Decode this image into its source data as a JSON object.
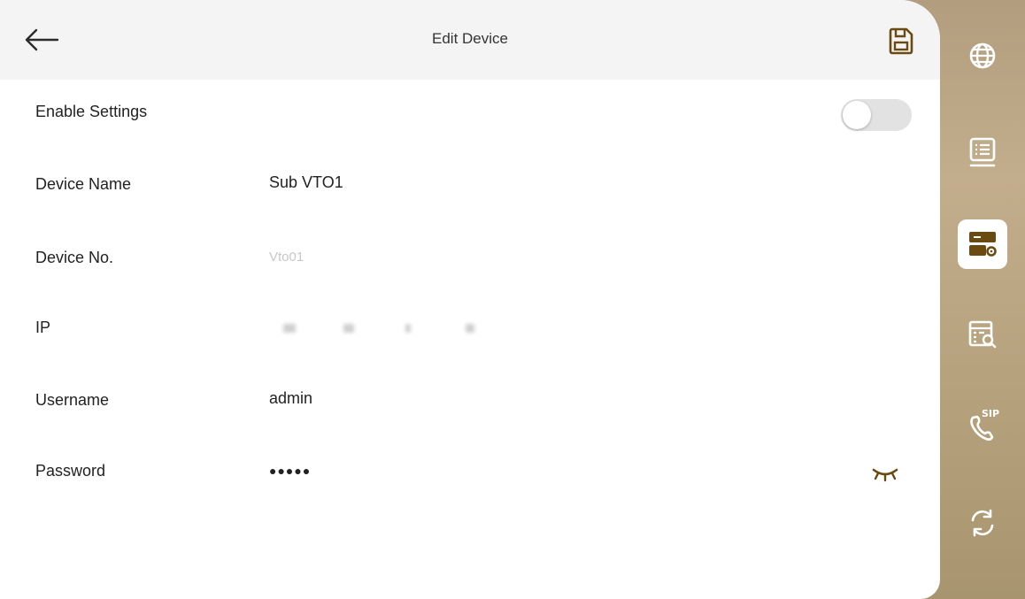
{
  "header": {
    "title": "Edit Device",
    "back_icon": "arrow-left-icon",
    "save_icon": "save-icon"
  },
  "form": {
    "enable_settings": {
      "label": "Enable Settings",
      "enabled": false
    },
    "device_name": {
      "label": "Device Name",
      "value": "Sub VTO1"
    },
    "device_no": {
      "label": "Device No.",
      "value": "Vto01"
    },
    "ip": {
      "label": "IP"
    },
    "username": {
      "label": "Username",
      "value": "admin"
    },
    "password": {
      "label": "Password",
      "value": "●●●●●"
    }
  },
  "sidebar": {
    "items": [
      {
        "icon": "globe-icon",
        "active": false
      },
      {
        "icon": "list-icon",
        "active": false
      },
      {
        "icon": "device-settings-icon",
        "active": true
      },
      {
        "icon": "search-list-icon",
        "active": false
      },
      {
        "icon": "sip-phone-icon",
        "label": "SIP",
        "active": false
      },
      {
        "icon": "refresh-icon",
        "active": false
      }
    ]
  },
  "colors": {
    "accent": "#6b4a12",
    "sidebar_bg": "#b8a37f",
    "header_bg": "#f4f4f4",
    "toggle_off": "#e2e2e2"
  }
}
